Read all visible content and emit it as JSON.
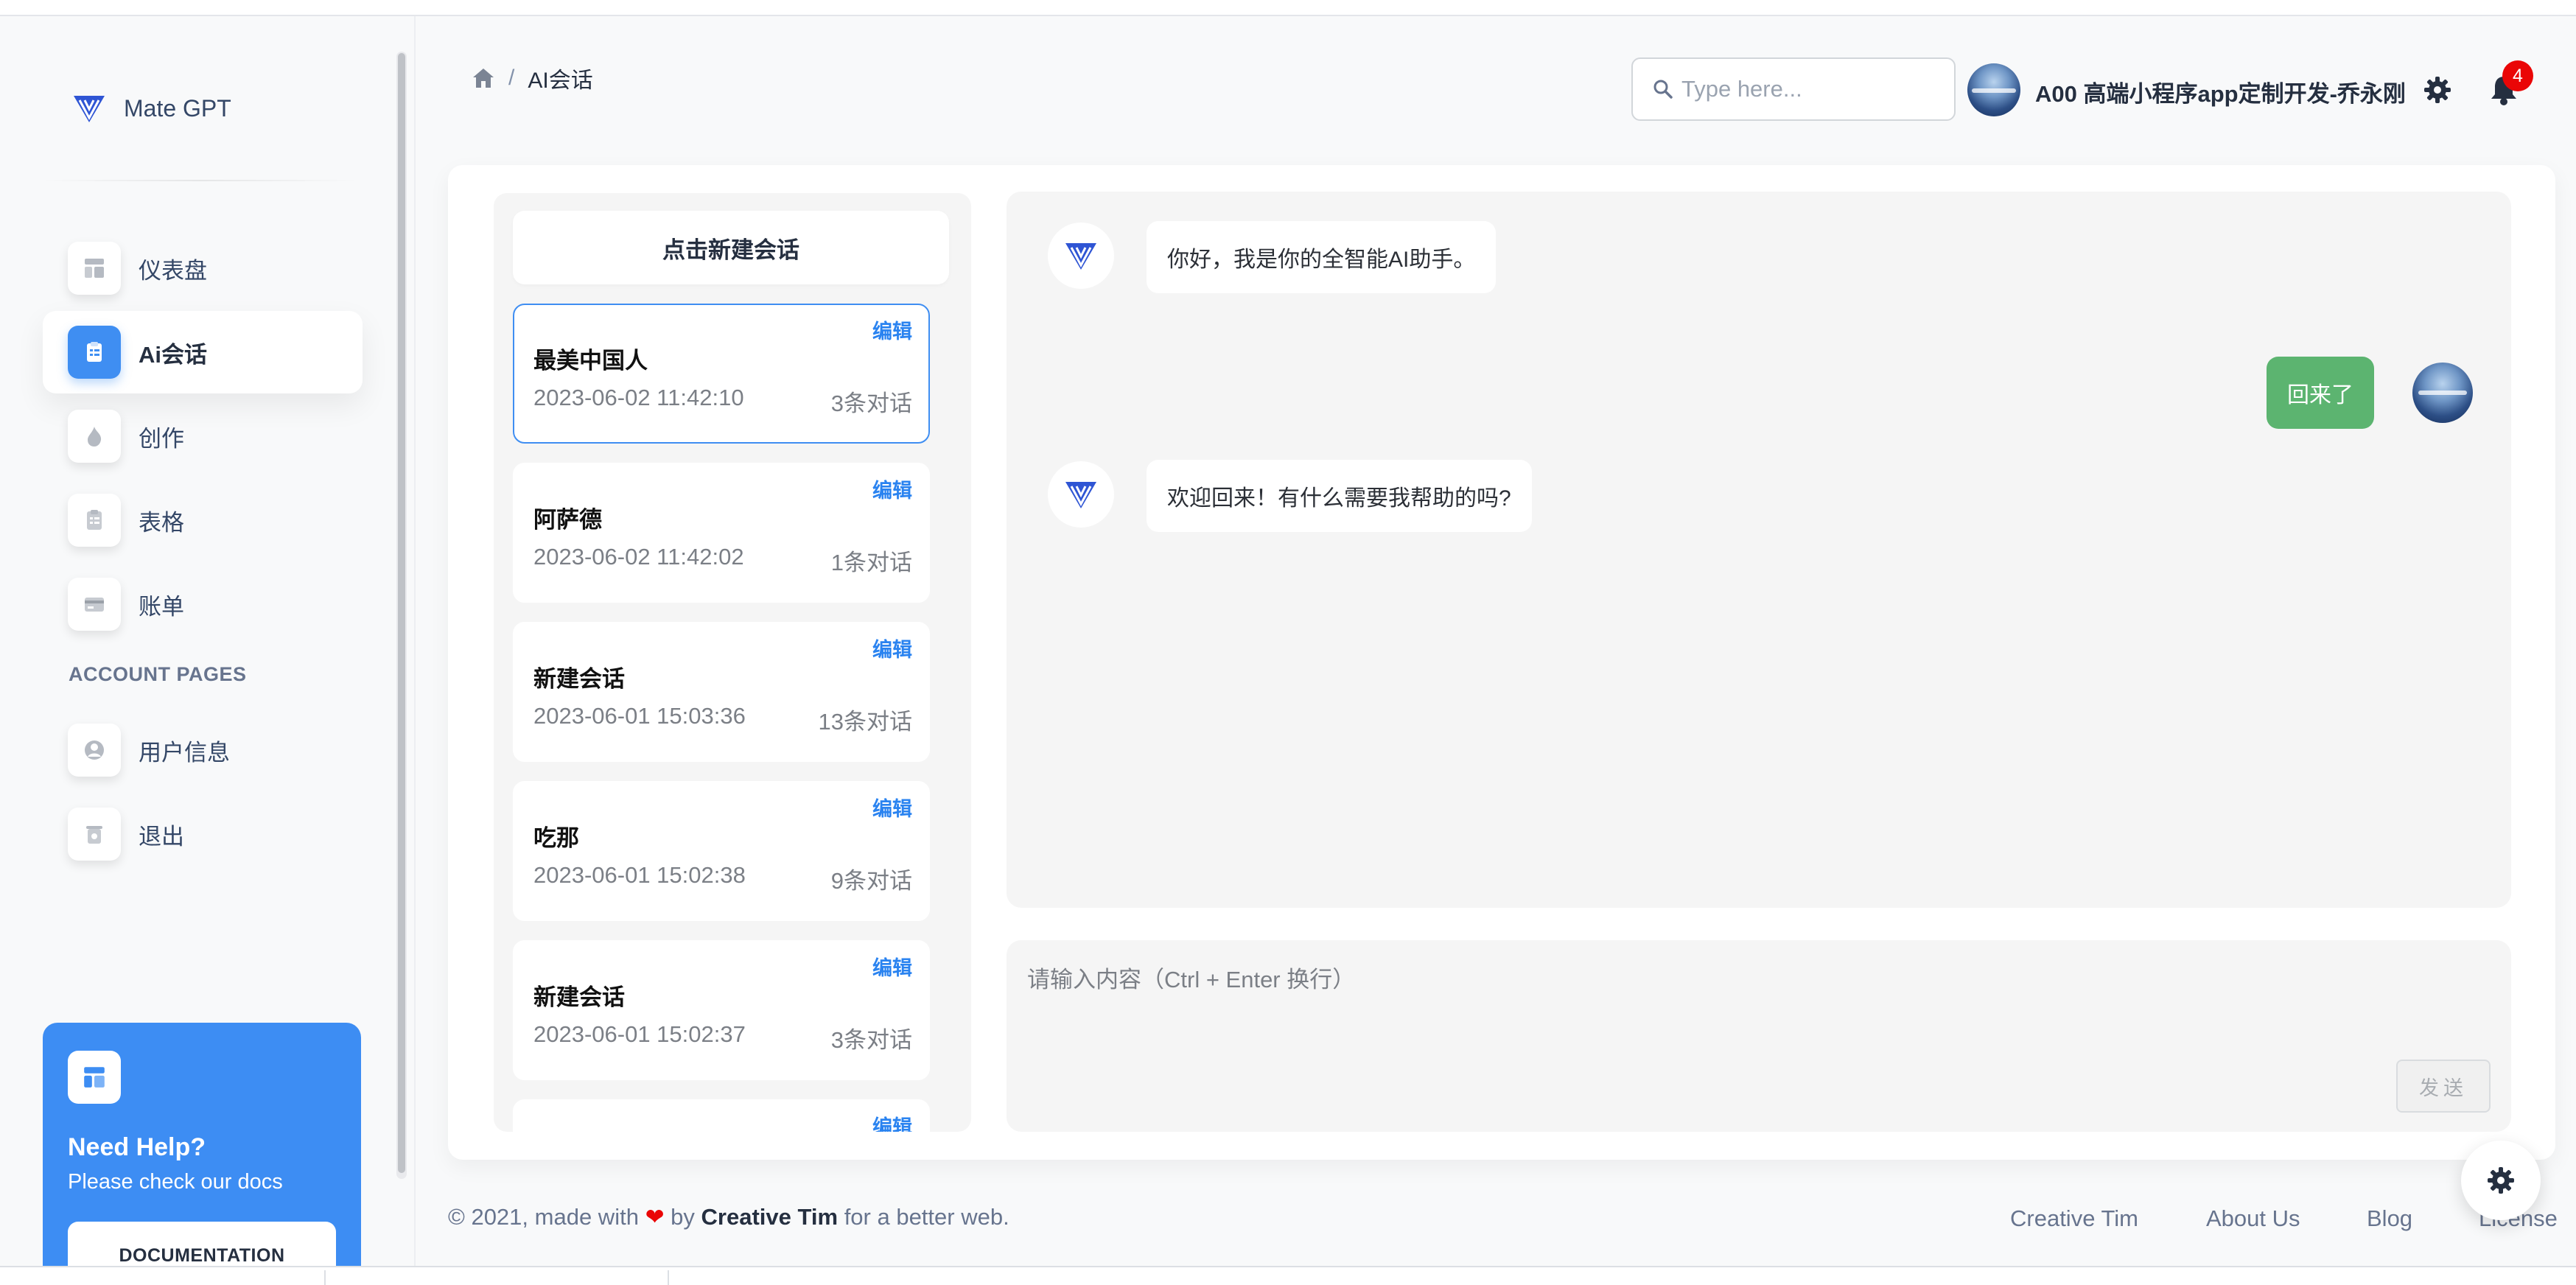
{
  "brand": {
    "name": "Mate GPT"
  },
  "sidebar": {
    "items": [
      {
        "label": "仪表盘",
        "icon": "dashboard-icon",
        "active": false
      },
      {
        "label": "Ai会话",
        "icon": "clipboard-icon",
        "active": true
      },
      {
        "label": "创作",
        "icon": "fire-icon",
        "active": false
      },
      {
        "label": "表格",
        "icon": "clipboard-list-icon",
        "active": false
      },
      {
        "label": "账单",
        "icon": "credit-card-icon",
        "active": false
      }
    ],
    "section_title": "ACCOUNT PAGES",
    "account_items": [
      {
        "label": "用户信息",
        "icon": "user-circle-icon"
      },
      {
        "label": "退出",
        "icon": "trash-icon"
      }
    ],
    "help": {
      "title": "Need Help?",
      "subtitle": "Please check our docs",
      "button": "DOCUMENTATION"
    }
  },
  "header": {
    "breadcrumb": {
      "current": "AI会话"
    },
    "search": {
      "placeholder": "Type here..."
    },
    "user_name": "A00 高端小程序app定制开发-乔永刚",
    "notification_count": "4"
  },
  "conversations": {
    "new_button": "点击新建会话",
    "edit_label": "编辑",
    "items": [
      {
        "title": "最美中国人",
        "time": "2023-06-02 11:42:10",
        "count": "3条对话",
        "selected": true
      },
      {
        "title": "阿萨德",
        "time": "2023-06-02 11:42:02",
        "count": "1条对话",
        "selected": false
      },
      {
        "title": "新建会话",
        "time": "2023-06-01 15:03:36",
        "count": "13条对话",
        "selected": false
      },
      {
        "title": "吃那",
        "time": "2023-06-01 15:02:38",
        "count": "9条对话",
        "selected": false
      },
      {
        "title": "新建会话",
        "time": "2023-06-01 15:02:37",
        "count": "3条对话",
        "selected": false
      }
    ]
  },
  "chat": {
    "messages": [
      {
        "role": "assistant",
        "text": "你好，我是你的全智能AI助手。"
      },
      {
        "role": "user",
        "text": "回来了"
      },
      {
        "role": "assistant",
        "text": "欢迎回来！有什么需要我帮助的吗?"
      }
    ],
    "input_placeholder": "请输入内容（Ctrl + Enter 换行）",
    "send_label": "发送"
  },
  "footer": {
    "copyright_prefix": "© 2021, made with",
    "heart": "❤",
    "by": "by",
    "author": "Creative Tim",
    "suffix": "for a better web.",
    "links": [
      "Creative Tim",
      "About Us",
      "Blog",
      "License"
    ]
  },
  "colors": {
    "accent": "#3f8ef2",
    "user_bubble": "#5cb470",
    "badge": "#ea0606",
    "help_card": "#3d8df3"
  }
}
